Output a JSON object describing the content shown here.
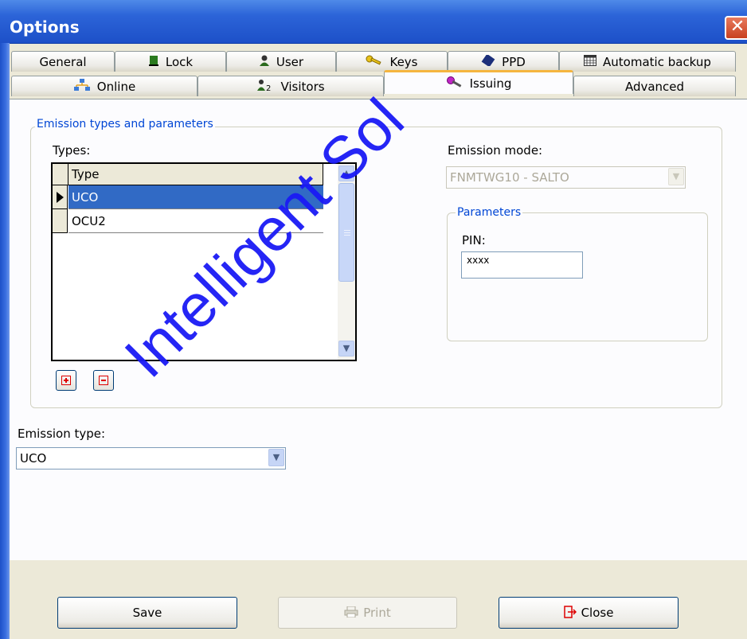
{
  "window": {
    "title": "Options",
    "close_glyph": "✕"
  },
  "tabs_row1": [
    {
      "label": "General",
      "icon": ""
    },
    {
      "label": "Lock",
      "icon": "door-icon"
    },
    {
      "label": "User",
      "icon": "user-icon"
    },
    {
      "label": "Keys",
      "icon": "key-icon"
    },
    {
      "label": "PPD",
      "icon": "ppd-device-icon"
    },
    {
      "label": "Automatic backup",
      "icon": "calendar-icon"
    }
  ],
  "tabs_row2": [
    {
      "label": "Online",
      "icon": "network-icon"
    },
    {
      "label": "Visitors",
      "icon": "visitors-icon"
    },
    {
      "label": "Issuing",
      "icon": "issuing-key-icon",
      "active": true
    },
    {
      "label": "Advanced",
      "icon": ""
    }
  ],
  "emission_group": {
    "legend": "Emission types and parameters",
    "types_label": "Types:",
    "grid": {
      "column_header": "Type",
      "rows": [
        {
          "value": "UCO",
          "selected": true
        },
        {
          "value": "OCU2",
          "selected": false
        }
      ]
    },
    "emission_mode_label": "Emission mode:",
    "emission_mode_value": "FNMTWG10 - SALTO",
    "parameters": {
      "legend": "Parameters",
      "pin_label": "PIN:",
      "pin_value": "xxxx"
    }
  },
  "emission_type": {
    "label": "Emission type:",
    "value": "UCO"
  },
  "buttons": {
    "save": "Save",
    "print": "Print",
    "close": "Close"
  },
  "watermark": {
    "text": "Intelligent Sol"
  },
  "colors": {
    "accent": "#316ac5",
    "title_bar": "#2c64d8",
    "group_legend": "#0046d5",
    "active_tab_highlight": "#f5b53f",
    "watermark": "#1a1af5"
  }
}
